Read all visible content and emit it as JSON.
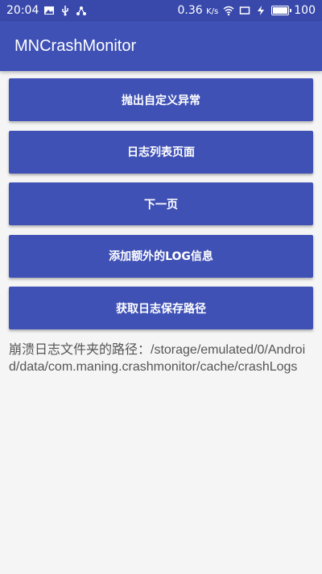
{
  "status_bar": {
    "time": "20:04",
    "net_speed_value": "0.36",
    "net_speed_unit": "K/s",
    "battery": "100",
    "battery_level": 1.0
  },
  "app_bar": {
    "title": "MNCrashMonitor"
  },
  "buttons": [
    {
      "label": "抛出自定义异常"
    },
    {
      "label": "日志列表页面"
    },
    {
      "label": "下一页"
    },
    {
      "label": "添加额外的LOG信息"
    },
    {
      "label": "获取日志保存路径"
    }
  ],
  "path_info": {
    "text": "崩溃日志文件夹的路径：/storage/emulated/0/Android/data/com.maning.crashmonitor/cache/crashLogs"
  },
  "colors": {
    "primary": "#3f51b5",
    "primary_dark": "#3949ab",
    "background": "#f5f5f5"
  }
}
